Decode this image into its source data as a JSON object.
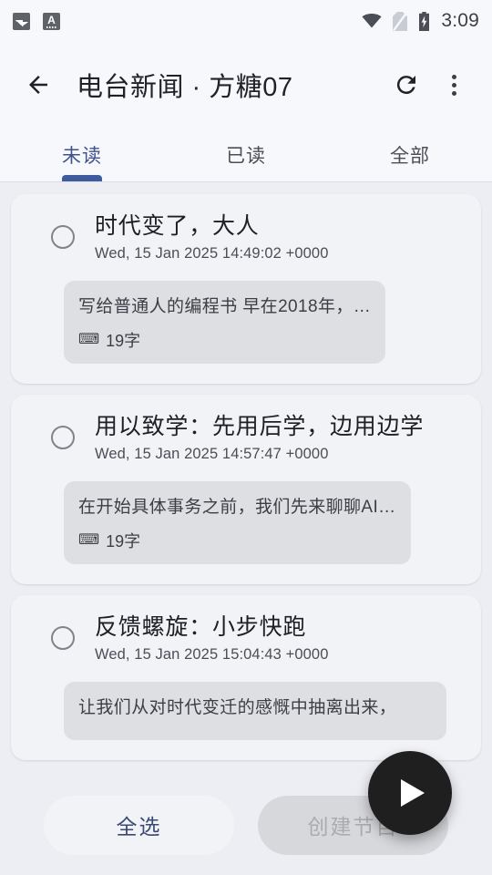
{
  "status_bar": {
    "time": "3:09",
    "notifications": [
      "image-icon",
      "translate-icon"
    ],
    "indicators": [
      "wifi-icon",
      "no-sim-icon",
      "battery-charging-icon"
    ]
  },
  "app_bar": {
    "back_icon": "arrow-back-icon",
    "title": "电台新闻 · 方糖07",
    "refresh_icon": "refresh-icon",
    "overflow_icon": "more-vertical-icon"
  },
  "tabs": {
    "active_index": 0,
    "items": [
      {
        "label": "未读"
      },
      {
        "label": "已读"
      },
      {
        "label": "全部"
      }
    ],
    "accent_color": "#3f5b9e"
  },
  "list": {
    "items": [
      {
        "title": "时代变了，大人",
        "date": "Wed, 15 Jan 2025 14:49:02 +0000",
        "snippet": "写给普通人的编程书 早在2018年，…",
        "word_count": "19字",
        "meta_icon": "⌨",
        "selected": false
      },
      {
        "title": "用以致学：先用后学，边用边学",
        "date": "Wed, 15 Jan 2025 14:57:47 +0000",
        "snippet": "在开始具体事务之前，我们先来聊聊AI…",
        "word_count": "19字",
        "meta_icon": "⌨",
        "selected": false
      },
      {
        "title": "反馈螺旋：小步快跑",
        "date": "Wed, 15 Jan 2025 15:04:43 +0000",
        "snippet": "让我们从对时代变迁的感慨中抽离出来，",
        "word_count": "",
        "meta_icon": "",
        "selected": false
      }
    ]
  },
  "bottom_bar": {
    "select_all_label": "全选",
    "create_label": "创建节目",
    "create_enabled": false
  },
  "fab": {
    "icon": "play-icon"
  },
  "colors": {
    "page_background": "#eceef4",
    "surface": "#f7f8fc",
    "card": "#f2f3f7",
    "bubble": "#dedfe2",
    "accent": "#3f5b9e",
    "fab": "#1f1f20"
  }
}
